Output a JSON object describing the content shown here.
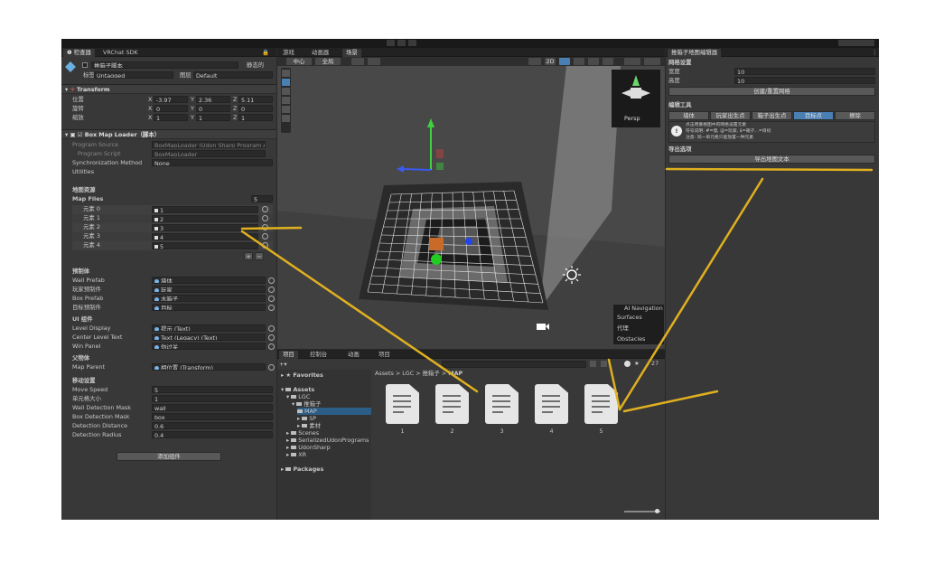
{
  "windowTabs": {
    "inspector": "检查器",
    "vrchat": "VRChat SDK",
    "game": "游戏",
    "animator": "动画器",
    "scene": "场景",
    "mapEditor": "推箱子地图编辑器",
    "project": "项目",
    "console": "控制台",
    "animation": "动画",
    "project2": "项目"
  },
  "inspector": {
    "objectName": "推箱子脚本",
    "staticLabel": "静态的",
    "tagLabel": "标签",
    "tagValue": "Untagged",
    "layerLabel": "图层",
    "layerValue": "Default",
    "transform": {
      "title": "Transform",
      "rows": [
        {
          "label": "位置",
          "x": "-3.97",
          "y": "2.36",
          "z": "5.11"
        },
        {
          "label": "旋转",
          "x": "0",
          "y": "0",
          "z": "0"
        },
        {
          "label": "缩放",
          "x": "1",
          "y": "1",
          "z": "1"
        }
      ]
    },
    "component": {
      "title": "Box Map Loader（脚本）",
      "programSourceLabel": "Program Source",
      "programSourceValue": "BoxMapLoader (Udon Sharp Program A",
      "programScriptLabel": "Program Script",
      "programScriptValue": "BoxMapLoader",
      "syncLabel": "Synchronization Method",
      "syncValue": "None",
      "utilities": "Utilities"
    },
    "mapSection": {
      "header": "地图资源",
      "mapFilesLabel": "Map Files",
      "count": "5",
      "elements": [
        {
          "label": "元素 0",
          "value": "1"
        },
        {
          "label": "元素 1",
          "value": "2"
        },
        {
          "label": "元素 2",
          "value": "3"
        },
        {
          "label": "元素 3",
          "value": "4"
        },
        {
          "label": "元素 4",
          "value": "5"
        }
      ]
    },
    "prefabSection": {
      "header": "预制体",
      "rows": [
        {
          "label": "Wall Prefab",
          "value": "墙体"
        },
        {
          "label": "玩家预制件",
          "value": "玩家"
        },
        {
          "label": "Box Prefab",
          "value": "木箱子"
        },
        {
          "label": "目标预制件",
          "value": "目标"
        }
      ]
    },
    "uiSection": {
      "header": "UI 组件",
      "rows": [
        {
          "label": "Level Display",
          "value": "提示 (Text)"
        },
        {
          "label": "Center Level Text",
          "value": "Text (Legacy) (Text)"
        },
        {
          "label": "Win Panel",
          "value": "你过关"
        }
      ]
    },
    "parentSection": {
      "header": "父物体",
      "rows": [
        {
          "label": "Map Parent",
          "value": "相位置 (Transform)"
        }
      ]
    },
    "moveSection": {
      "header": "移动设置",
      "rows": [
        {
          "label": "Move Speed",
          "value": "5"
        },
        {
          "label": "单元格大小",
          "value": "1"
        },
        {
          "label": "Wall Detection Mask",
          "value": "wall"
        },
        {
          "label": "Box Detection Mask",
          "value": "box"
        },
        {
          "label": "Detection Distance",
          "value": "0.6"
        },
        {
          "label": "Detection Radius",
          "value": "0.4"
        }
      ]
    },
    "addComponent": "添加组件"
  },
  "scene": {
    "centerLabel": "中心",
    "globalLabel": "全局",
    "mode2d": "2D",
    "persp": "Persp",
    "nav": {
      "title": "AI Navigation",
      "items": [
        "Surfaces",
        "代理",
        "Obstacles"
      ]
    }
  },
  "project": {
    "favorites": "Favorites",
    "assets": "Assets",
    "tree": [
      "LGC",
      "推箱子",
      "MAP",
      "SP",
      "素材",
      "Scenes",
      "SerializedUdonPrograms",
      "UdonSharp",
      "XR",
      "Packages"
    ],
    "breadcrumb": [
      "Assets",
      "LGC",
      "推箱子",
      "MAP"
    ],
    "files": [
      "1",
      "2",
      "3",
      "4",
      "5"
    ],
    "count": "27"
  },
  "mapEditor": {
    "gridHeader": "网格设置",
    "widthLabel": "宽度",
    "widthValue": "10",
    "heightLabel": "高度",
    "heightValue": "10",
    "createGrid": "创建/重置网格",
    "toolsHeader": "编辑工具",
    "tools": [
      "墙体",
      "玩家出生点",
      "箱子出生点",
      "目标点",
      "擦除"
    ],
    "activeTool": "目标点",
    "info": [
      "点击用塞格图中的网格设置元素",
      "符号说明: #=墙, @=玩家, $=箱子, .=目标",
      "注意: 同一单元格只能放置一种元素"
    ],
    "exportHeader": "导出选项",
    "exportButton": "导出地图文本"
  },
  "colors": {
    "accent": "#4a7fb4",
    "annotation": "#e0b020",
    "selected": "#2c5d87"
  }
}
